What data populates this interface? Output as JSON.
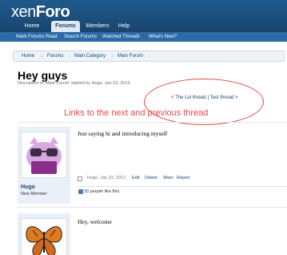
{
  "brand": {
    "name_prefix": "xen",
    "name_suffix": "Foro"
  },
  "nav": {
    "tabs": [
      {
        "label": "Home"
      },
      {
        "label": "Forums"
      },
      {
        "label": "Members"
      },
      {
        "label": "Help"
      }
    ],
    "subnav": [
      "Mark Forums Read",
      "Search Forums",
      "Watched Threads",
      "What's New?"
    ]
  },
  "breadcrumb": [
    "Home",
    "Forums",
    "Main Category",
    "Main Forum"
  ],
  "thread": {
    "title": "Hey guys",
    "description": "Discussion in 'Main Forum' started by Hugo, Jan 23, 2012.",
    "prev_link": "< The Lol thread",
    "separator": "|",
    "next_link": "Test thread >"
  },
  "annotation": {
    "text": "Links to the next and previous thread",
    "color": "#e64b4b"
  },
  "posts": [
    {
      "author": "Hugo",
      "user_title": "New Member",
      "message": "Just saying hi and introducing myself",
      "date": "Hugo, Jan 23, 2012",
      "actions": [
        "Edit",
        "Delete",
        "Warn",
        "Report"
      ],
      "likes": "33 people like this.",
      "avatar_icon": "pig-sunglasses-avatar-icon"
    },
    {
      "message": "Hey, welcome",
      "avatar_icon": "butterfly-avatar-icon"
    }
  ],
  "colors": {
    "header": "#1e5a8c",
    "link": "#17456b",
    "sidebar": "#e9f0f7"
  }
}
